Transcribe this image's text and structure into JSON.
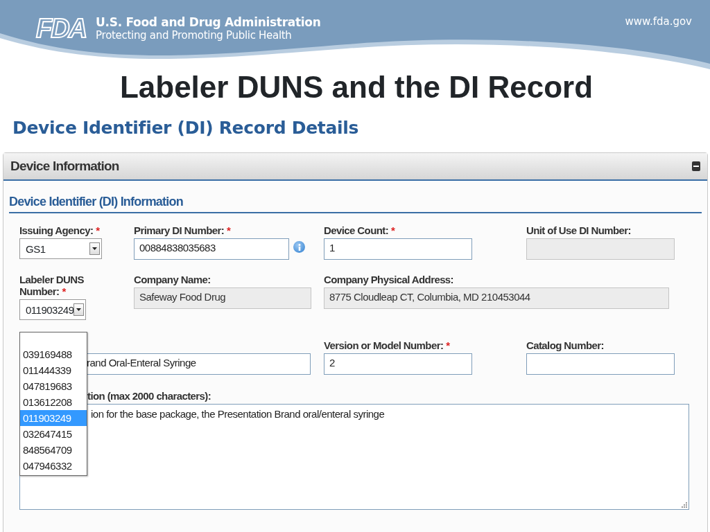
{
  "slide": {
    "logo": "FDA",
    "organization": "U.S. Food and Drug Administration",
    "tagline": "Protecting and Promoting Public Health",
    "website": "www.fda.gov",
    "title": "Labeler DUNS and the DI Record"
  },
  "page_heading": "Device Identifier (DI) Record Details",
  "panel": {
    "title": "Device Information",
    "expanded": true,
    "section_title": "Device Identifier (DI) Information",
    "rows": [
      [
        {
          "kind": "select",
          "label": "Issuing Agency:",
          "required_mark": "*",
          "value": "GS1"
        },
        {
          "kind": "text",
          "label": "Primary DI Number:",
          "required_mark": "*",
          "value": "00884838035683",
          "disabled": false,
          "info": true
        },
        {
          "kind": "text",
          "label": "Device Count:",
          "required_mark": "*",
          "value": "1",
          "disabled": false
        },
        {
          "kind": "text",
          "label": "Unit of Use DI Number:",
          "disabled": true
        }
      ],
      [
        {
          "kind": "select",
          "label": "Labeler DUNS Number:",
          "required_mark": "*",
          "value": "011903249"
        },
        {
          "kind": "text",
          "label": "Company Name:",
          "value": "Safeway Food Drug",
          "disabled": true
        },
        {
          "kind": "text",
          "label": "Company Physical Address:",
          "value": "8775 Cloudleap CT, Columbia, MD 210453044",
          "disabled": true
        }
      ],
      [
        {
          "kind": "text",
          "value": "rand Oral-Enteral Syringe",
          "disabled": false
        },
        "",
        {
          "kind": "text",
          "label": "Version or Model Number:",
          "required_mark": "*",
          "value": "2",
          "disabled": false
        },
        {
          "kind": "text",
          "label": "Catalog Number:",
          "disabled": false
        }
      ],
      [
        {
          "kind": "textarea",
          "label": "tion (max 2000 characters):",
          "value": "ion for the base package, the Presentation Brand oral/enteral syringe"
        }
      ]
    ]
  },
  "dropdown": {
    "options": [
      {
        "label": "039169488",
        "selected": false
      },
      {
        "label": "011444339",
        "selected": false
      },
      {
        "label": "047819683",
        "selected": false
      },
      {
        "label": "013612208",
        "selected": false
      },
      {
        "label": "011903249",
        "selected": true
      },
      {
        "label": "032647415",
        "selected": false
      },
      {
        "label": "848564709",
        "selected": false
      },
      {
        "label": "047946332",
        "selected": false
      }
    ]
  }
}
